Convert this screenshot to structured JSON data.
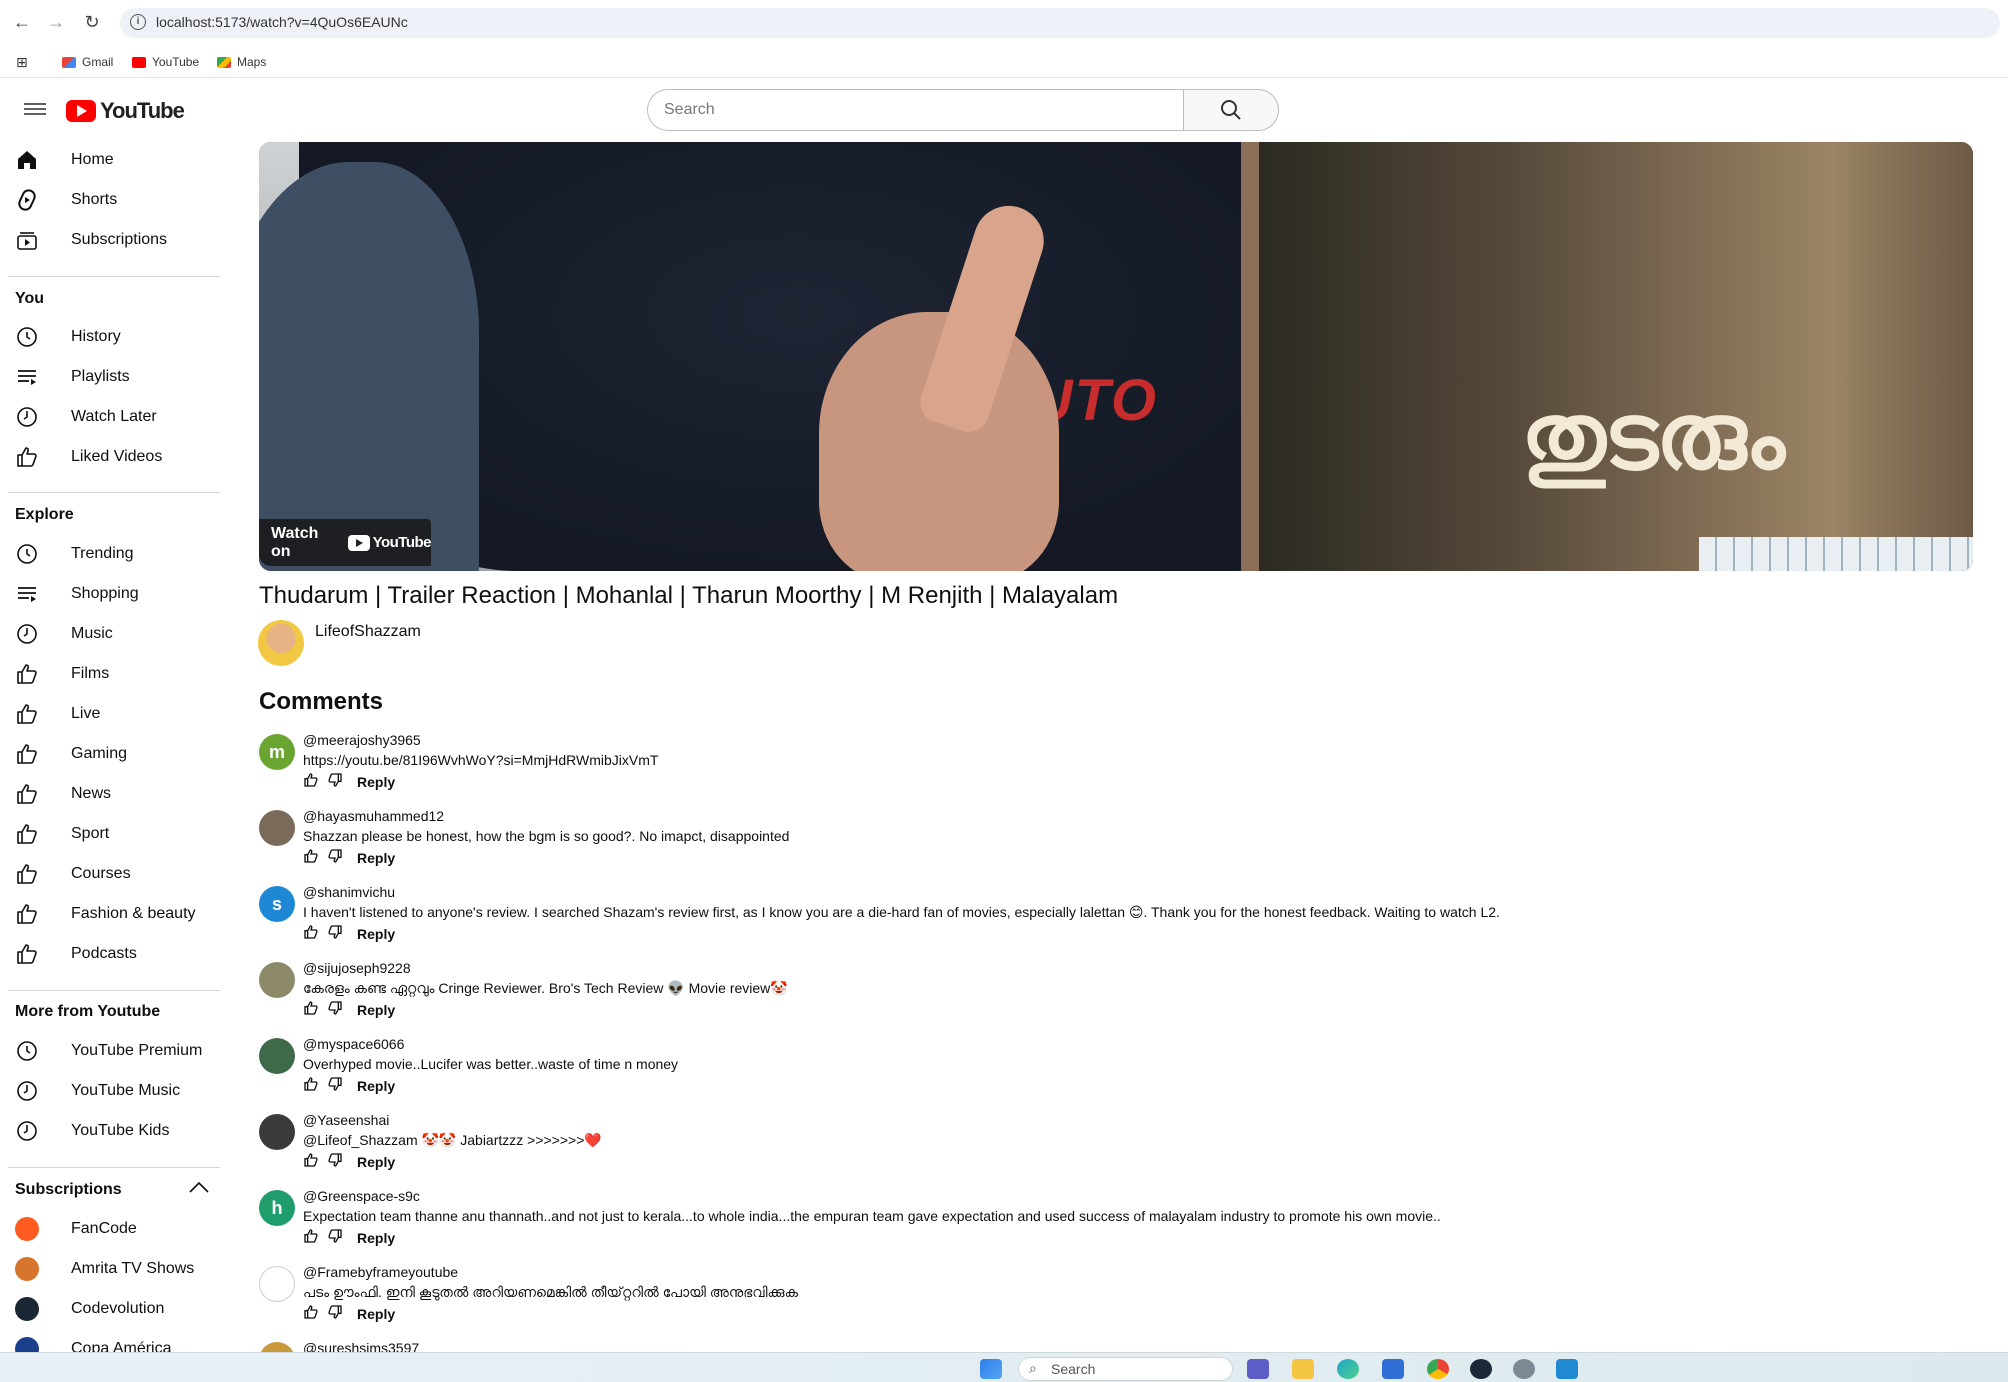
{
  "browser": {
    "url": "localhost:5173/watch?v=4QuOs6EAUNc",
    "bookmarks": [
      "Gmail",
      "YouTube",
      "Maps"
    ]
  },
  "header": {
    "logo_text": "YouTube",
    "search_placeholder": "Search"
  },
  "sidebar": {
    "main": [
      {
        "label": "Home",
        "icon": "home-icon"
      },
      {
        "label": "Shorts",
        "icon": "shorts-icon"
      },
      {
        "label": "Subscriptions",
        "icon": "subscriptions-icon"
      }
    ],
    "you_heading": "You",
    "you": [
      {
        "label": "History",
        "icon": "history-icon"
      },
      {
        "label": "Playlists",
        "icon": "playlists-icon"
      },
      {
        "label": "Watch Later",
        "icon": "clock-icon"
      },
      {
        "label": "Liked Videos",
        "icon": "thumbs-up-icon"
      }
    ],
    "explore_heading": "Explore",
    "explore": [
      {
        "label": "Trending",
        "icon": "history-icon"
      },
      {
        "label": "Shopping",
        "icon": "playlists-icon"
      },
      {
        "label": "Music",
        "icon": "clock-icon"
      },
      {
        "label": "Films",
        "icon": "thumbs-up-icon"
      },
      {
        "label": "Live",
        "icon": "thumbs-up-icon"
      },
      {
        "label": "Gaming",
        "icon": "thumbs-up-icon"
      },
      {
        "label": "News",
        "icon": "thumbs-up-icon"
      },
      {
        "label": "Sport",
        "icon": "thumbs-up-icon"
      },
      {
        "label": "Courses",
        "icon": "thumbs-up-icon"
      },
      {
        "label": "Fashion & beauty",
        "icon": "thumbs-up-icon"
      },
      {
        "label": "Podcasts",
        "icon": "thumbs-up-icon"
      }
    ],
    "more_heading": "More from Youtube",
    "more": [
      {
        "label": "YouTube Premium",
        "icon": "history-icon"
      },
      {
        "label": "YouTube Music",
        "icon": "clock-icon"
      },
      {
        "label": "YouTube Kids",
        "icon": "clock-icon"
      }
    ],
    "subs_heading": "Subscriptions",
    "subscriptions": [
      {
        "label": "FanCode",
        "color": "#ff5a1f"
      },
      {
        "label": "Amrita TV Shows",
        "color": "#d8752d"
      },
      {
        "label": "Codevolution",
        "color": "#1b2733"
      },
      {
        "label": "Copa América",
        "color": "#1c3f8c"
      }
    ]
  },
  "video": {
    "watch_on": "Watch on",
    "watch_on_brand": "YouTube",
    "title": "Thudarum | Trailer Reaction | Mohanlal | Tharun Moorthy | M Renjith | Malayalam",
    "art_text": "തുടരും",
    "shirt_text": "NARUTO",
    "channel": "LifeofShazzam"
  },
  "comments_heading": "Comments",
  "reply_label": "Reply",
  "comments": [
    {
      "author": "@meerajoshy3965",
      "text": "https://youtu.be/81I96WvhWoY?si=MmjHdRWmibJixVmT",
      "avatar_letter": "m",
      "avatar_color": "#6aa532"
    },
    {
      "author": "@hayasmuhammed12",
      "text": "Shazzan please be honest, how the bgm is so good?. No imapct, disappointed",
      "avatar_letter": "",
      "avatar_color": "#7a6a5a"
    },
    {
      "author": "@shanimvichu",
      "text": "I haven't listened to anyone's review. I searched Shazam's review first, as I know you are a die-hard fan of movies, especially lalettan 😊. Thank you for the honest feedback. Waiting to watch L2.",
      "avatar_letter": "s",
      "avatar_color": "#1e88d4"
    },
    {
      "author": "@sijujoseph9228",
      "text": "കേരളം കണ്ട ഏറ്റവും Cringe Reviewer. Bro's Tech Review 👽 Movie review🤡",
      "avatar_letter": "",
      "avatar_color": "#8d8a6a"
    },
    {
      "author": "@myspace6066",
      "text": "Overhyped movie..Lucifer was better..waste of time n money",
      "avatar_letter": "",
      "avatar_color": "#3f6a4a"
    },
    {
      "author": "@Yaseenshai",
      "text": "@Lifeof_Shazzam 🤡🤡 Jabiartzzz >>>>>>>❤️",
      "avatar_letter": "",
      "avatar_color": "#3b3b3b"
    },
    {
      "author": "@Greenspace-s9c",
      "text": "Expectation team thanne anu thannath..and not just to kerala...to whole india...the empuran team gave expectation and used success of malayalam industry to promote his own movie..",
      "avatar_letter": "h",
      "avatar_color": "#1f9d6a"
    },
    {
      "author": "@Framebyframeyoutube",
      "text": "പടം ഊംഫി. ഇനി കൂടുതൽ അറിയണമെങ്കിൽ തീയ്റ്ററിൽ പോയി അനുഭവിക്കുക",
      "avatar_letter": "",
      "avatar_color": "#ffffff"
    },
    {
      "author": "@sureshsims3597",
      "text": "",
      "avatar_letter": "",
      "avatar_color": "#c99a3a"
    }
  ],
  "taskbar": {
    "search_placeholder": "Search"
  }
}
